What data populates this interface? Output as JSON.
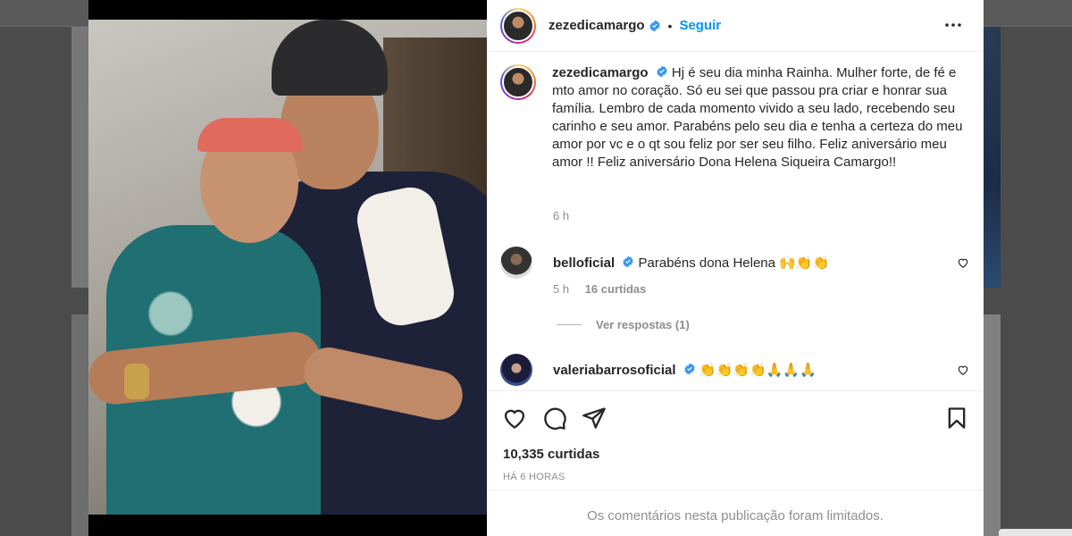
{
  "post": {
    "username": "zezedicamargo",
    "separator": "•",
    "follow_label": "Seguir",
    "caption": "Hj é seu dia minha Rainha. Mulher forte, de fé e mto amor no coração. Só eu sei que passou pra criar e honrar sua família. Lembro de cada momento vivido a seu lado, recebendo seu carinho e seu amor. Parabéns pelo seu dia e tenha a certeza do meu amor por vc e o qt sou feliz por ser seu filho. Feliz aniversário meu amor !! Feliz aniversário Dona Helena Siqueira Camargo!!",
    "caption_time": "6 h"
  },
  "comments": [
    {
      "username": "belloficial",
      "text": "Parabéns dona Helena",
      "emoji": "🙌👏👏",
      "time": "5 h",
      "likes": "16 curtidas",
      "replies_label": "Ver respostas (1)"
    },
    {
      "username": "valeriabarrosoficial",
      "text": "",
      "emoji": "👏👏👏👏🙏🙏🙏"
    }
  ],
  "footer": {
    "likes": "10,335 curtidas",
    "posted_ago": "HÁ 6 HORAS",
    "comments_limited": "Os comentários nesta publicação foram limitados."
  },
  "colors": {
    "accent": "#0095f6",
    "verified": "#3897f0",
    "text": "#262626",
    "muted": "#8e8e8e"
  }
}
